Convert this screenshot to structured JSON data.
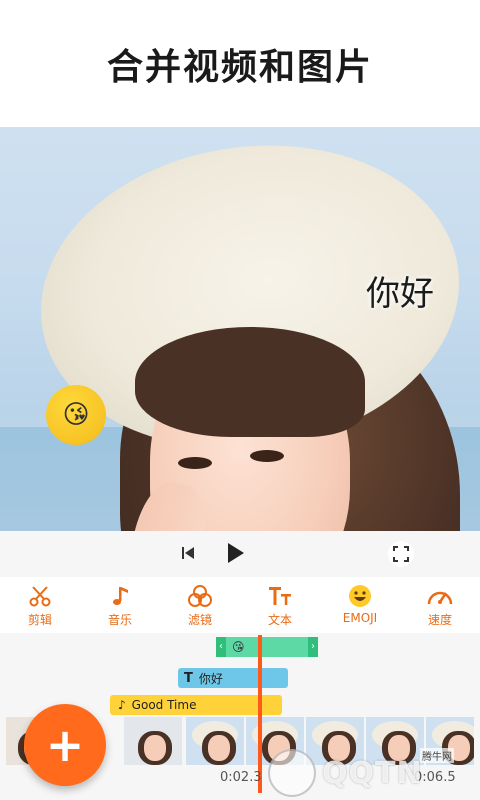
{
  "header": {
    "title": "合并视频和图片"
  },
  "preview": {
    "sticker_text": "你好",
    "emoji": "😘"
  },
  "toolbar": {
    "items": [
      {
        "icon": "scissors-icon",
        "label": "剪辑"
      },
      {
        "icon": "music-note-icon",
        "label": "音乐"
      },
      {
        "icon": "filter-icon",
        "label": "滤镜"
      },
      {
        "icon": "text-icon",
        "label": "文本"
      },
      {
        "icon": "emoji-icon",
        "label": "EMOJI"
      },
      {
        "icon": "speed-gauge-icon",
        "label": "速度"
      }
    ]
  },
  "timeline": {
    "text_track": "你好",
    "music_track": "Good Time",
    "current_time": "0:02.3",
    "total_time": "0:06.5"
  },
  "fab": {
    "symbol": "+"
  },
  "watermark": {
    "brand": "QQTN",
    "site": "腾牛网"
  },
  "colors": {
    "accent": "#ff6a1c",
    "emoji_track": "#5dd9a6",
    "text_track": "#6ec7e8",
    "music_track": "#ffd23a"
  }
}
